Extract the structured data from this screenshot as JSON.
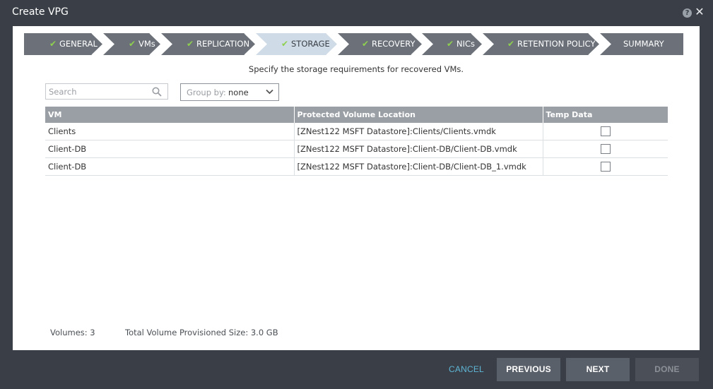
{
  "dialog": {
    "title": "Create VPG",
    "help_icon": "question-circle-icon",
    "close_icon": "close-x-icon"
  },
  "wizard_steps": [
    {
      "label": "GENERAL",
      "complete": true,
      "active": false
    },
    {
      "label": "VMs",
      "complete": true,
      "active": false
    },
    {
      "label": "REPLICATION",
      "complete": true,
      "active": false
    },
    {
      "label": "STORAGE",
      "complete": true,
      "active": true
    },
    {
      "label": "RECOVERY",
      "complete": true,
      "active": false
    },
    {
      "label": "NICs",
      "complete": true,
      "active": false
    },
    {
      "label": "RETENTION POLICY",
      "complete": true,
      "active": false
    },
    {
      "label": "SUMMARY",
      "complete": false,
      "active": false
    }
  ],
  "instruction": "Specify the storage requirements for recovered VMs.",
  "search": {
    "placeholder": "Search",
    "value": ""
  },
  "group_by": {
    "label": "Group by:",
    "value": "none"
  },
  "table": {
    "columns": [
      "VM",
      "Protected Volume Location",
      "Temp Data"
    ],
    "rows": [
      {
        "vm": "Clients",
        "location": "[ZNest122 MSFT Datastore]:Clients/Clients.vmdk",
        "temp_data": false
      },
      {
        "vm": "Client-DB",
        "location": "[ZNest122 MSFT Datastore]:Client-DB/Client-DB.vmdk",
        "temp_data": false
      },
      {
        "vm": "Client-DB",
        "location": "[ZNest122 MSFT Datastore]:Client-DB/Client-DB_1.vmdk",
        "temp_data": false
      }
    ]
  },
  "summary": {
    "volumes": "Volumes: 3",
    "total_size": "Total Volume Provisioned Size: 3.0 GB"
  },
  "buttons": {
    "cancel": "CANCEL",
    "previous": "PREVIOUS",
    "next": "NEXT",
    "done": "DONE"
  },
  "colors": {
    "step_bg": "#6b7079",
    "step_active_bg": "#cfdbe6",
    "check": "#8fd14f",
    "accent_link": "#5fb6d6"
  }
}
